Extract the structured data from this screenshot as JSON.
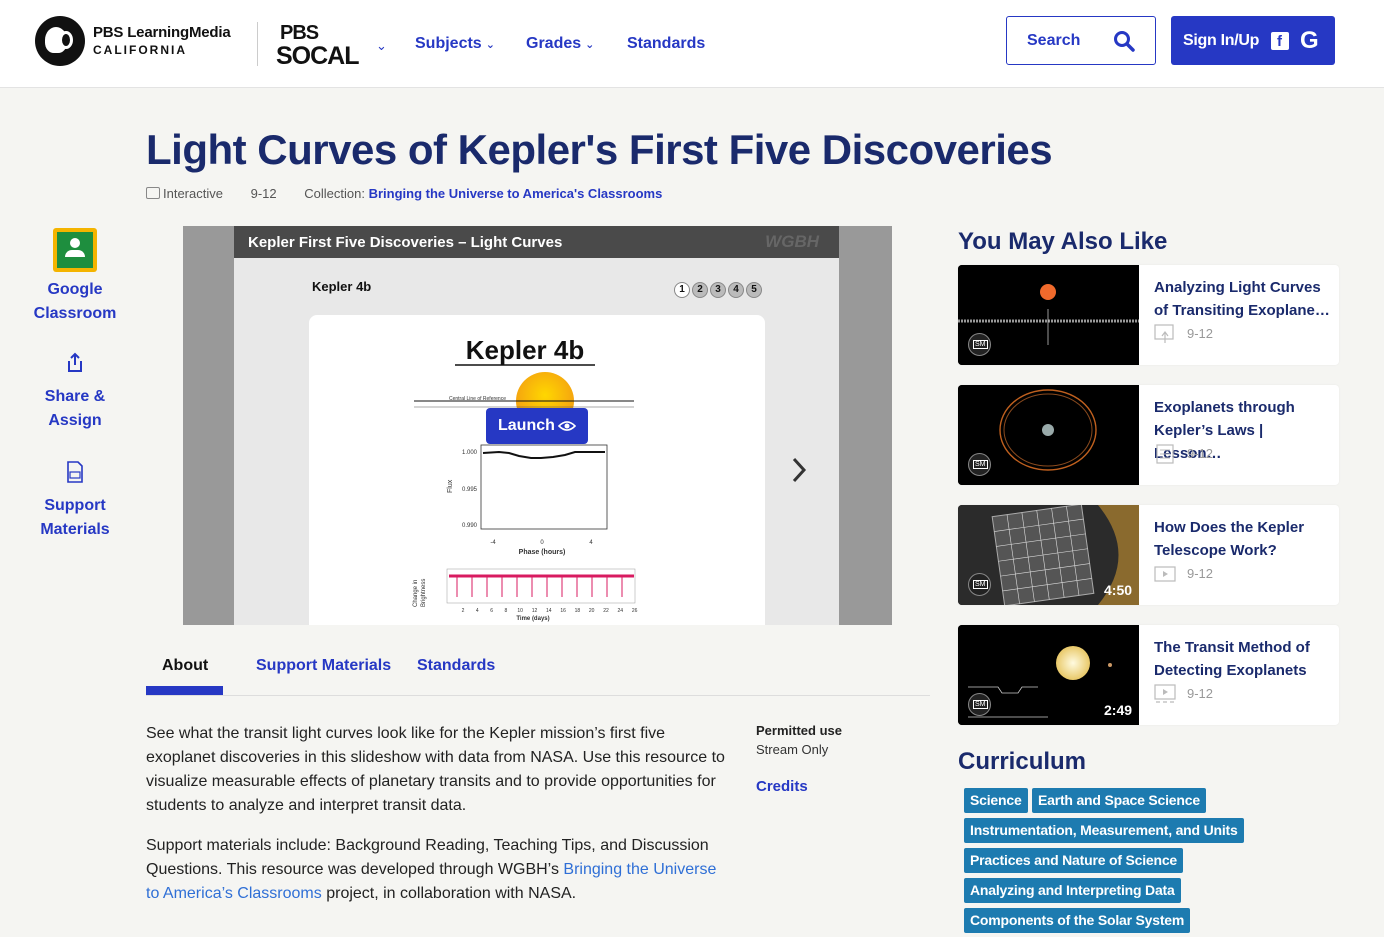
{
  "header": {
    "logo_line1": "PBS LearningMedia",
    "logo_line2": "CALIFORNIA",
    "station_line1": "PBS",
    "station_line2": "SOCAL",
    "nav": [
      {
        "label": "Subjects"
      },
      {
        "label": "Grades"
      },
      {
        "label": "Standards"
      }
    ],
    "search_label": "Search",
    "signin_label": "Sign In/Up"
  },
  "resource": {
    "title": "Light Curves of Kepler's First Five Discoveries",
    "type": "Interactive",
    "grade": "9-12",
    "collection_label": "Collection:",
    "collection_name": "Bringing the Universe to America's Classrooms"
  },
  "actions": [
    {
      "label_line1": "Google",
      "label_line2": "Classroom"
    },
    {
      "label_line1": "Share &",
      "label_line2": "Assign"
    },
    {
      "label_line1": "Support",
      "label_line2": "Materials"
    }
  ],
  "media": {
    "bar_title": "Kepler First Five Discoveries – Light Curves",
    "bar_brand": "WGBH",
    "slide_label": "Kepler 4b",
    "pages": [
      "1",
      "2",
      "3",
      "4",
      "5"
    ],
    "card_title": "Kepler 4b",
    "reference_label": "Central Line of Reference",
    "flux_label": "Flux",
    "flux_ticks": [
      "1.000",
      "0.995",
      "0.990"
    ],
    "phase_ticks": [
      "-4",
      "0",
      "4"
    ],
    "phase_label": "Phase (hours)",
    "brightness_label_1": "Change in",
    "brightness_label_2": "Brightness",
    "day_ticks": [
      "2",
      "4",
      "6",
      "8",
      "10",
      "12",
      "14",
      "16",
      "18",
      "20",
      "22",
      "24",
      "26"
    ],
    "time_label": "Time (days)",
    "launch_label": "Launch"
  },
  "tabs": [
    {
      "label": "About"
    },
    {
      "label": "Support Materials"
    },
    {
      "label": "Standards"
    }
  ],
  "about": {
    "para1": "See what the transit light curves look like for the Kepler mission’s first five exoplanet discoveries in this slideshow with data from NASA. Use this resource to visualize measurable effects of planetary transits and to provide opportunities for students to analyze and interpret transit data.",
    "para2_before": "Support materials include: Background Reading, Teaching Tips, and Discussion Questions. This resource was developed through WGBH’s ",
    "para2_link": "Bringing the Universe to America’s Classrooms",
    "para2_after": " project, in collaboration with NASA.",
    "permitted_title": "Permitted use",
    "permitted_value": "Stream Only",
    "credits": "Credits"
  },
  "ymal": {
    "title": "You May Also Like",
    "items": [
      {
        "title": "Analyzing Light Curves of Transiting Exoplane…",
        "grade": "9-12",
        "duration": ""
      },
      {
        "title": "Exoplanets through Kepler’s Laws | Lesson…",
        "grade": "9-12",
        "duration": ""
      },
      {
        "title": "How Does the Kepler Telescope Work?",
        "grade": "9-12",
        "duration": "4:50"
      },
      {
        "title": "The Transit Method of Detecting Exoplanets",
        "grade": "9-12",
        "duration": "2:49"
      }
    ]
  },
  "curriculum": {
    "title": "Curriculum",
    "tags": [
      "Science",
      "Earth and Space Science",
      "Instrumentation, Measurement, and Units",
      "Practices and Nature of Science",
      "Analyzing and Interpreting Data",
      "Components of the Solar System"
    ]
  },
  "colors": {
    "brand_blue": "#2638c4",
    "title_navy": "#1a2a6c",
    "tag_teal": "#1d7bb0"
  }
}
